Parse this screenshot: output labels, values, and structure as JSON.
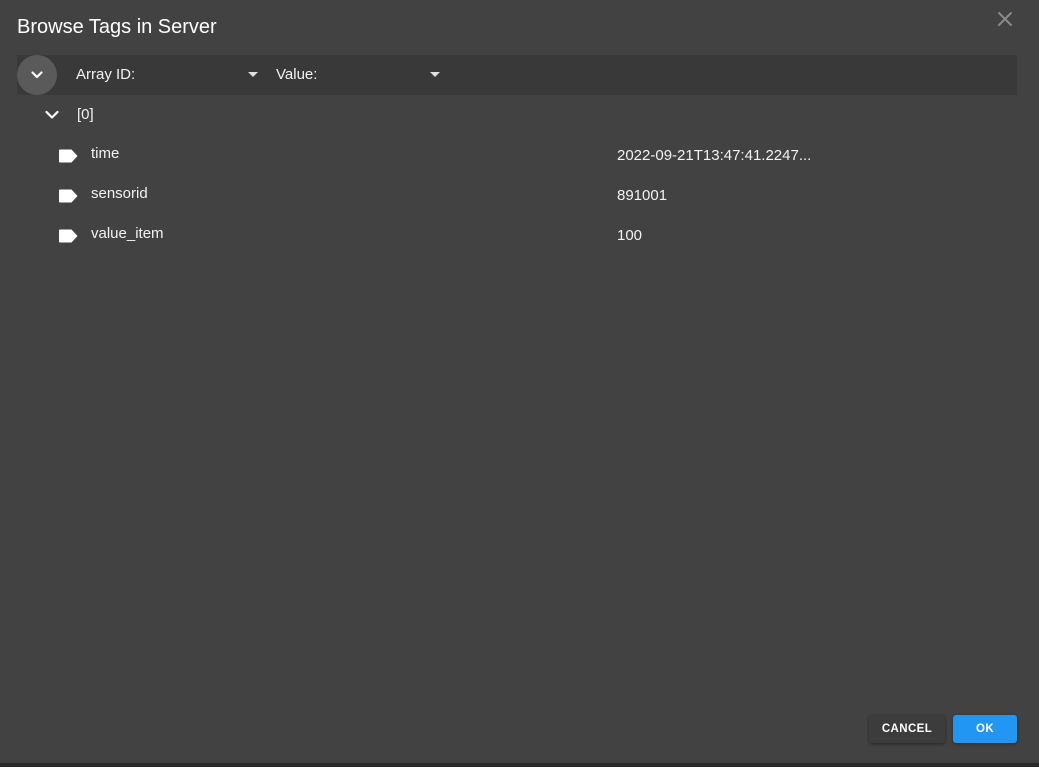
{
  "dialog": {
    "title": "Browse Tags in Server",
    "close_icon": "close-icon"
  },
  "toolbar": {
    "toggle_icon": "chevron-down-icon",
    "array_id_label": "Array ID:",
    "value_label": "Value:"
  },
  "tree": {
    "root": {
      "label": "[0]",
      "expanded": true,
      "children": [
        {
          "name": "time",
          "value": "2022-09-21T13:47:41.2247...",
          "icon": "tag-icon"
        },
        {
          "name": "sensorid",
          "value": "891001",
          "icon": "tag-icon"
        },
        {
          "name": "value_item",
          "value": "100",
          "icon": "tag-icon"
        }
      ]
    }
  },
  "actions": {
    "cancel_label": "CANCEL",
    "ok_label": "OK"
  },
  "colors": {
    "background": "#424242",
    "toolbar": "#393939",
    "primary": "#2196f3"
  }
}
